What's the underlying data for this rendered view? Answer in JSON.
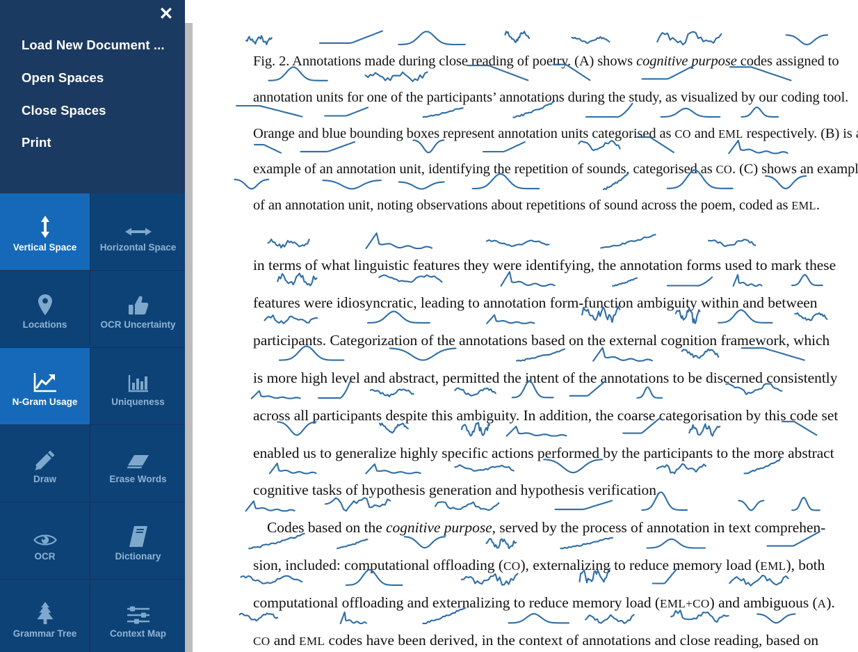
{
  "menu": {
    "close_icon": "close-icon",
    "items": [
      {
        "label": "Load New Document ..."
      },
      {
        "label": "Open Spaces"
      },
      {
        "label": "Close Spaces"
      },
      {
        "label": "Print"
      }
    ]
  },
  "tools": [
    {
      "label": "Vertical Space",
      "icon": "vertical-arrows-icon",
      "active": true
    },
    {
      "label": "Horizontal Space",
      "icon": "horizontal-arrows-icon",
      "active": false
    },
    {
      "label": "Locations",
      "icon": "map-pin-icon",
      "active": false
    },
    {
      "label": "OCR Uncertainty",
      "icon": "thumbs-up-icon",
      "active": false
    },
    {
      "label": "N-Gram Usage",
      "icon": "line-chart-icon",
      "active": true
    },
    {
      "label": "Uniqueness",
      "icon": "bar-chart-icon",
      "active": false
    },
    {
      "label": "Draw",
      "icon": "pencil-icon",
      "active": false
    },
    {
      "label": "Erase Words",
      "icon": "eraser-icon",
      "active": false
    },
    {
      "label": "OCR",
      "icon": "eye-icon",
      "active": false
    },
    {
      "label": "Dictionary",
      "icon": "book-icon",
      "active": false
    },
    {
      "label": "Grammar Tree",
      "icon": "tree-icon",
      "active": false
    },
    {
      "label": "Context Map",
      "icon": "sliders-icon",
      "active": false
    }
  ],
  "colors": {
    "menu_background": "#1b3a61",
    "tile_inactive": "#0d4277",
    "tile_active": "#1569b8",
    "tile_label_inactive": "#8fb4d4",
    "tile_label_active": "#ffffff",
    "sparkline": "#2f6ea6",
    "document_background": "#ffffff",
    "scrollbar": "#c4c4c4"
  },
  "document": {
    "caption_lines": [
      {
        "id": "c0",
        "segments": [
          {
            "t": "Fig. 2.  Annotations made during close reading of poetry. (A) shows "
          },
          {
            "t": "cognitive purpose",
            "s": "it"
          },
          {
            "t": " codes assigned to"
          }
        ]
      },
      {
        "id": "c1",
        "segments": [
          {
            "t": "annotation units for one of the participants’ annotations during the study, as visualized by our coding tool."
          }
        ]
      },
      {
        "id": "c2",
        "segments": [
          {
            "t": "Orange and blue bounding boxes represent annotation units categorised as "
          },
          {
            "t": "CO",
            "s": "sc"
          },
          {
            "t": " and "
          },
          {
            "t": "EML",
            "s": "sc"
          },
          {
            "t": " respectively. (B) is an"
          }
        ]
      },
      {
        "id": "c3",
        "segments": [
          {
            "t": "example of an annotation unit, identifying the repetition of sounds, categorised as "
          },
          {
            "t": "CO",
            "s": "sc"
          },
          {
            "t": ". (C) shows an example"
          }
        ]
      },
      {
        "id": "c4",
        "segments": [
          {
            "t": "of an annotation unit, noting observations about repetitions of sound across the poem, coded as "
          },
          {
            "t": "EML",
            "s": "sc"
          },
          {
            "t": "."
          }
        ]
      }
    ],
    "body_lines": [
      {
        "id": "b0",
        "segments": [
          {
            "t": "in terms of what linguistic features they were identifying, the annotation forms used to mark these"
          }
        ]
      },
      {
        "id": "b1",
        "segments": [
          {
            "t": "features were idiosyncratic, leading to annotation form-function ambiguity within and between"
          }
        ]
      },
      {
        "id": "b2",
        "segments": [
          {
            "t": "participants. Categorization of the annotations based on the external cognition framework, which"
          }
        ]
      },
      {
        "id": "b3",
        "segments": [
          {
            "t": "is more high level and abstract, permitted the intent of the annotations to be discerned consistently"
          }
        ]
      },
      {
        "id": "b4",
        "segments": [
          {
            "t": "across all participants despite this ambiguity. In addition, the coarse categorisation by this code set"
          }
        ]
      },
      {
        "id": "b5",
        "segments": [
          {
            "t": "enabled us to generalize highly specific actions performed by the participants to the more abstract"
          }
        ]
      },
      {
        "id": "b6",
        "segments": [
          {
            "t": "cognitive tasks of hypothesis generation and hypothesis verification."
          }
        ]
      },
      {
        "id": "b7",
        "indent": true,
        "segments": [
          {
            "t": "Codes based on the "
          },
          {
            "t": "cognitive purpose",
            "s": "it"
          },
          {
            "t": ", served by the process of annotation in text comprehen-"
          }
        ]
      },
      {
        "id": "b8",
        "segments": [
          {
            "t": "sion, included: computational offloading ("
          },
          {
            "t": "CO",
            "s": "sc"
          },
          {
            "t": "), externalizing to reduce memory load ("
          },
          {
            "t": "EML",
            "s": "sc"
          },
          {
            "t": "), both"
          }
        ]
      },
      {
        "id": "b9",
        "segments": [
          {
            "t": "computational offloading and externalizing to reduce memory load ("
          },
          {
            "t": "EML+CO",
            "s": "sc"
          },
          {
            "t": ") and ambiguous ("
          },
          {
            "t": "A",
            "s": "sc"
          },
          {
            "t": ")."
          }
        ]
      },
      {
        "id": "b10",
        "segments": [
          {
            "t": "CO",
            "s": "sc"
          },
          {
            "t": " and "
          },
          {
            "t": "EML",
            "s": "sc"
          },
          {
            "t": " codes have been derived, in the context of annotations and close reading, based on"
          }
        ]
      }
    ]
  }
}
